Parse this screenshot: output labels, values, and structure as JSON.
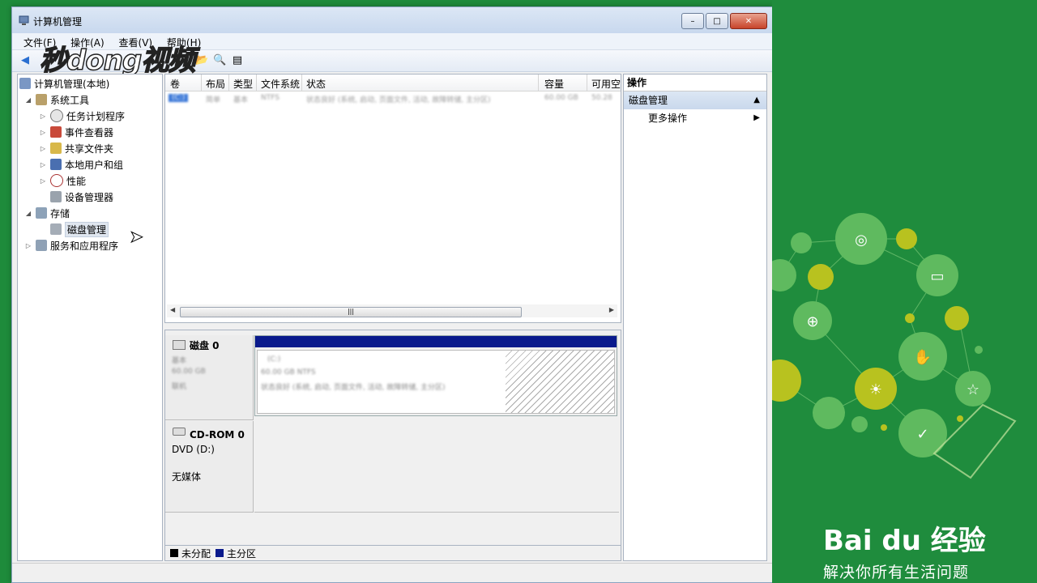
{
  "window": {
    "title": "计算机管理",
    "minimize": "–",
    "maximize": "□",
    "close": "✕"
  },
  "menu": [
    "文件(F)",
    "操作(A)",
    "查看(V)",
    "帮助(H)"
  ],
  "watermark": "秒dong视频",
  "tree": {
    "root": "计算机管理(本地)",
    "system_tools": "系统工具",
    "task_scheduler": "任务计划程序",
    "event_viewer": "事件查看器",
    "shared_folders": "共享文件夹",
    "local_users": "本地用户和组",
    "performance": "性能",
    "device_manager": "设备管理器",
    "storage": "存储",
    "disk_management": "磁盘管理",
    "services_apps": "服务和应用程序"
  },
  "list": {
    "columns": [
      "卷",
      "布局",
      "类型",
      "文件系统",
      "状态",
      "容量",
      "可用空"
    ],
    "row": [
      "(C:)",
      "简单",
      "基本",
      "NTFS",
      "状态良好 (系统, 启动, 页面文件, 活动, 故障转储, 主分区)",
      "60.00 GB",
      "50.28"
    ]
  },
  "disks": {
    "disk0": {
      "title": "磁盘 0",
      "type": "基本",
      "size": "60.00 GB",
      "status": "联机"
    },
    "volume": {
      "name": "(C:)",
      "detail": "60.00 GB NTFS",
      "status": "状态良好 (系统, 启动, 页面文件, 活动, 故障转储, 主分区)"
    },
    "cdrom": {
      "title": "CD-ROM 0",
      "drive": "DVD (D:)",
      "media": "无媒体"
    }
  },
  "legend": {
    "unallocated": "未分配",
    "primary": "主分区"
  },
  "actions": {
    "header": "操作",
    "section": "磁盘管理",
    "more": "更多操作"
  },
  "brand": {
    "logo": "Bai du 经验",
    "slogan": "解决你所有生活问题"
  },
  "colors": {
    "background": "#1e8b3b",
    "primary_partition": "#0a1a8c",
    "unallocated": "#000000"
  }
}
